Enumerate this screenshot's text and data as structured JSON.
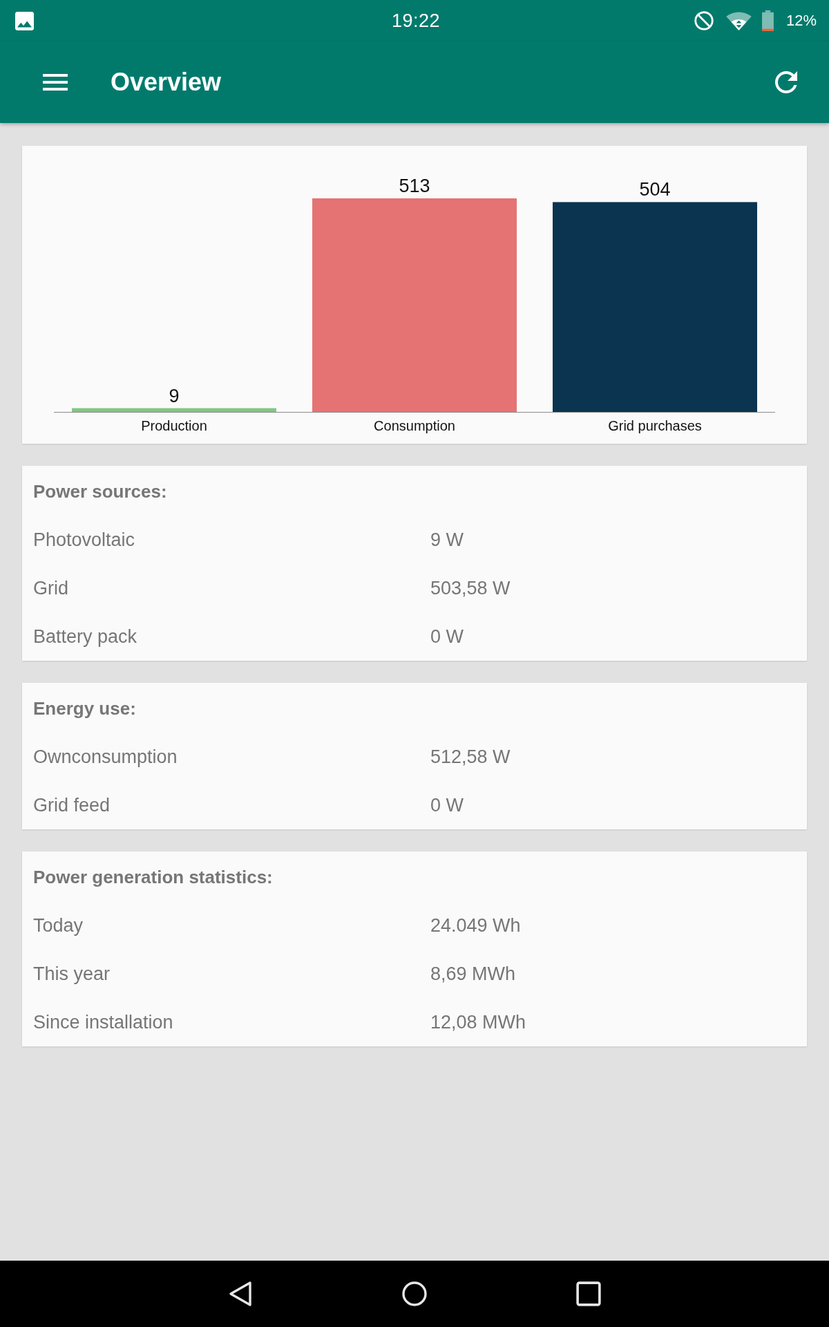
{
  "status_bar": {
    "time": "19:22",
    "battery_percent": "12%"
  },
  "app_bar": {
    "title": "Overview"
  },
  "chart_card": {
    "chart_data": {
      "type": "bar",
      "categories": [
        "Production",
        "Consumption",
        "Grid purchases"
      ],
      "values": [
        9,
        513,
        504
      ],
      "colors": [
        "#81c784",
        "#e57373",
        "#0a3450"
      ],
      "data_labels": true
    }
  },
  "sections": [
    {
      "title": "Power sources:",
      "rows": [
        {
          "label": "Photovoltaic",
          "value": "9 W"
        },
        {
          "label": "Grid",
          "value": "503,58 W"
        },
        {
          "label": "Battery pack",
          "value": "0 W"
        }
      ]
    },
    {
      "title": "Energy use:",
      "rows": [
        {
          "label": "Ownconsumption",
          "value": "512,58 W"
        },
        {
          "label": "Grid feed",
          "value": "0 W"
        }
      ]
    },
    {
      "title": "Power generation statistics:",
      "rows": [
        {
          "label": "Today",
          "value": "24.049 Wh"
        },
        {
          "label": "This year",
          "value": "8,69 MWh"
        },
        {
          "label": "Since installation",
          "value": "12,08 MWh"
        }
      ]
    }
  ]
}
